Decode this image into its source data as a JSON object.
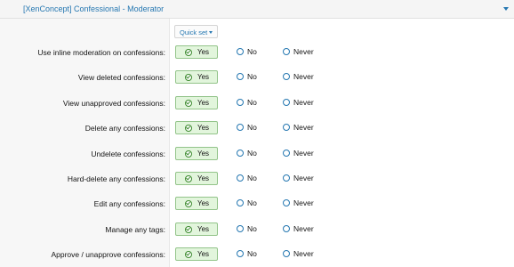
{
  "header": {
    "title": "[XenConcept] Confessional - Moderator"
  },
  "quick_set": {
    "label": "Quick set"
  },
  "permissions": [
    {
      "label": "Use inline moderation on confessions:",
      "selected": "Yes"
    },
    {
      "label": "View deleted confessions:",
      "selected": "Yes"
    },
    {
      "label": "View unapproved confessions:",
      "selected": "Yes"
    },
    {
      "label": "Delete any confessions:",
      "selected": "Yes"
    },
    {
      "label": "Undelete confessions:",
      "selected": "Yes"
    },
    {
      "label": "Hard-delete any confessions:",
      "selected": "Yes"
    },
    {
      "label": "Edit any confessions:",
      "selected": "Yes"
    },
    {
      "label": "Manage any tags:",
      "selected": "Yes"
    },
    {
      "label": "Approve / unapprove confessions:",
      "selected": "Yes"
    }
  ],
  "options": {
    "yes": "Yes",
    "no": "No",
    "never": "Never"
  },
  "colors": {
    "accent": "#2577b1",
    "yes_bg": "#e2f5dc",
    "yes_border": "#93c48a"
  }
}
